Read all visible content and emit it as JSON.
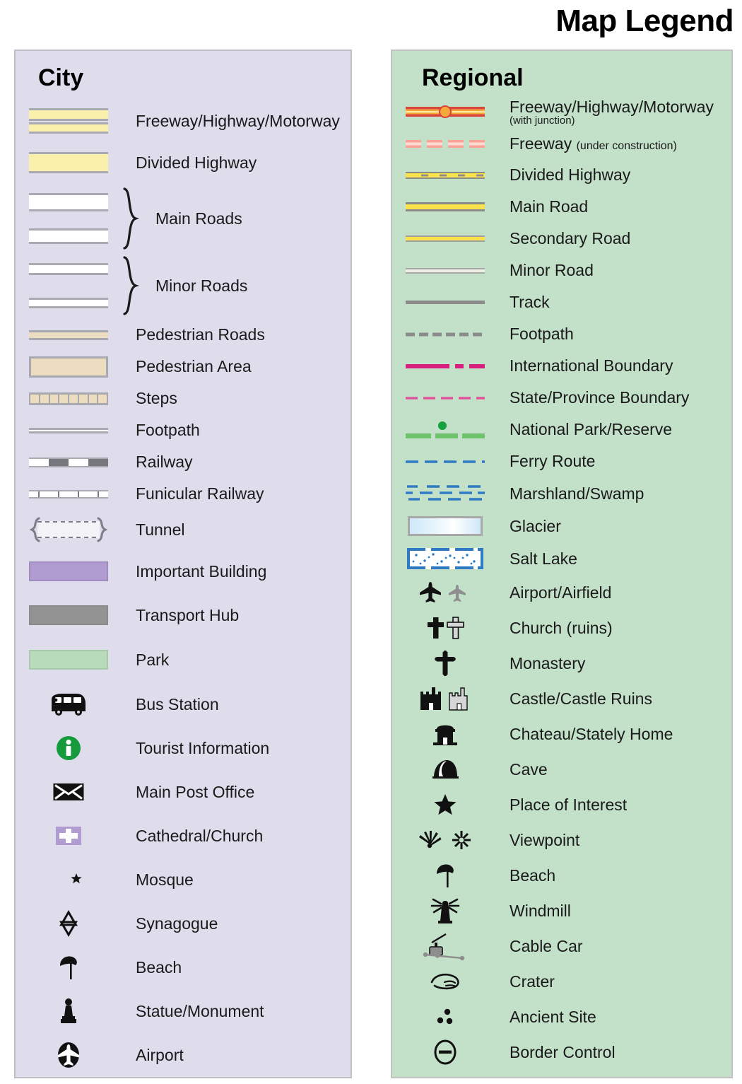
{
  "title": "Map Legend",
  "city": {
    "heading": "City",
    "items": [
      {
        "label": "Freeway/Highway/Motorway",
        "icon": "city-freeway-symbol"
      },
      {
        "label": "Divided Highway",
        "icon": "city-divided-highway-symbol"
      },
      {
        "label": "Main Roads",
        "icon": "city-main-roads-symbol"
      },
      {
        "label": "Minor Roads",
        "icon": "city-minor-roads-symbol"
      },
      {
        "label": "Pedestrian Roads",
        "icon": "city-pedestrian-road-symbol"
      },
      {
        "label": "Pedestrian Area",
        "icon": "city-pedestrian-area-symbol"
      },
      {
        "label": "Steps",
        "icon": "city-steps-symbol"
      },
      {
        "label": "Footpath",
        "icon": "city-footpath-symbol"
      },
      {
        "label": "Railway",
        "icon": "city-railway-symbol"
      },
      {
        "label": "Funicular Railway",
        "icon": "city-funicular-railway-symbol"
      },
      {
        "label": "Tunnel",
        "icon": "city-tunnel-symbol"
      },
      {
        "label": "Important Building",
        "icon": "city-important-building-swatch"
      },
      {
        "label": "Transport Hub",
        "icon": "city-transport-hub-swatch"
      },
      {
        "label": "Park",
        "icon": "city-park-swatch"
      },
      {
        "label": "Bus Station",
        "icon": "bus-icon"
      },
      {
        "label": "Tourist Information",
        "icon": "information-icon"
      },
      {
        "label": "Main Post Office",
        "icon": "envelope-icon"
      },
      {
        "label": "Cathedral/Church",
        "icon": "cross-square-icon"
      },
      {
        "label": "Mosque",
        "icon": "crescent-star-icon"
      },
      {
        "label": "Synagogue",
        "icon": "star-of-david-icon"
      },
      {
        "label": "Beach",
        "icon": "beach-umbrella-icon"
      },
      {
        "label": "Statue/Monument",
        "icon": "statue-icon"
      },
      {
        "label": "Airport",
        "icon": "airport-circle-icon"
      }
    ]
  },
  "regional": {
    "heading": "Regional",
    "items": [
      {
        "label": "Freeway/Highway/Motorway",
        "sublabel": "(with junction)",
        "icon": "regional-freeway-junction-symbol"
      },
      {
        "label": "Freeway",
        "inline_note": "(under construction)",
        "icon": "regional-freeway-construction-symbol"
      },
      {
        "label": "Divided Highway",
        "icon": "regional-divided-highway-symbol"
      },
      {
        "label": "Main Road",
        "icon": "regional-main-road-symbol"
      },
      {
        "label": "Secondary Road",
        "icon": "regional-secondary-road-symbol"
      },
      {
        "label": "Minor Road",
        "icon": "regional-minor-road-symbol"
      },
      {
        "label": "Track",
        "icon": "regional-track-symbol"
      },
      {
        "label": "Footpath",
        "icon": "regional-footpath-symbol"
      },
      {
        "label": "International Boundary",
        "icon": "international-boundary-symbol"
      },
      {
        "label": "State/Province Boundary",
        "icon": "state-boundary-symbol"
      },
      {
        "label": "National Park/Reserve",
        "icon": "national-park-symbol"
      },
      {
        "label": "Ferry Route",
        "icon": "ferry-route-symbol"
      },
      {
        "label": "Marshland/Swamp",
        "icon": "marshland-symbol"
      },
      {
        "label": "Glacier",
        "icon": "glacier-swatch"
      },
      {
        "label": "Salt Lake",
        "icon": "salt-lake-swatch"
      },
      {
        "label": "Airport/Airfield",
        "icon": "airplane-icon"
      },
      {
        "label": "Church (ruins)",
        "icon": "church-cross-icon"
      },
      {
        "label": "Monastery",
        "icon": "monastery-cross-icon"
      },
      {
        "label": "Castle/Castle Ruins",
        "icon": "castle-icon"
      },
      {
        "label": "Chateau/Stately Home",
        "icon": "chateau-icon"
      },
      {
        "label": "Cave",
        "icon": "cave-icon"
      },
      {
        "label": "Place of Interest",
        "icon": "star-icon"
      },
      {
        "label": "Viewpoint",
        "icon": "viewpoint-icon"
      },
      {
        "label": "Beach",
        "icon": "beach-umbrella-icon"
      },
      {
        "label": "Windmill",
        "icon": "windmill-icon"
      },
      {
        "label": "Cable Car",
        "icon": "cable-car-icon"
      },
      {
        "label": "Crater",
        "icon": "crater-icon"
      },
      {
        "label": "Ancient Site",
        "icon": "ancient-site-icon"
      },
      {
        "label": "Border Control",
        "icon": "border-control-icon"
      }
    ]
  },
  "colors": {
    "city_panel_bg": "#dfdcec",
    "regional_panel_bg": "#c3e0c9",
    "highway_yellow": "#fbf0ab",
    "road_casing_gray": "#a9a9b2",
    "pedestrian_tan": "#ecdcc0",
    "important_building_purple": "#b09cd0",
    "transport_hub_gray": "#939393",
    "park_green": "#b8dcbb",
    "tourist_info_green": "#159a3c",
    "freeway_red": "#d8453c",
    "freeway_orange": "#f5a93a",
    "freeway_construction_pink": "#f9a396",
    "main_road_yellow": "#fae24b",
    "track_gray": "#8b8b8b",
    "international_boundary_magenta": "#d81f7e",
    "state_boundary_pink": "#e0549b",
    "national_park_green": "#6fc16e",
    "national_park_dot": "#16a03e",
    "ferry_blue": "#2e7bc4",
    "glacier_blue": "#cfe7f7",
    "salt_lake_blue": "#2e7bc4"
  }
}
